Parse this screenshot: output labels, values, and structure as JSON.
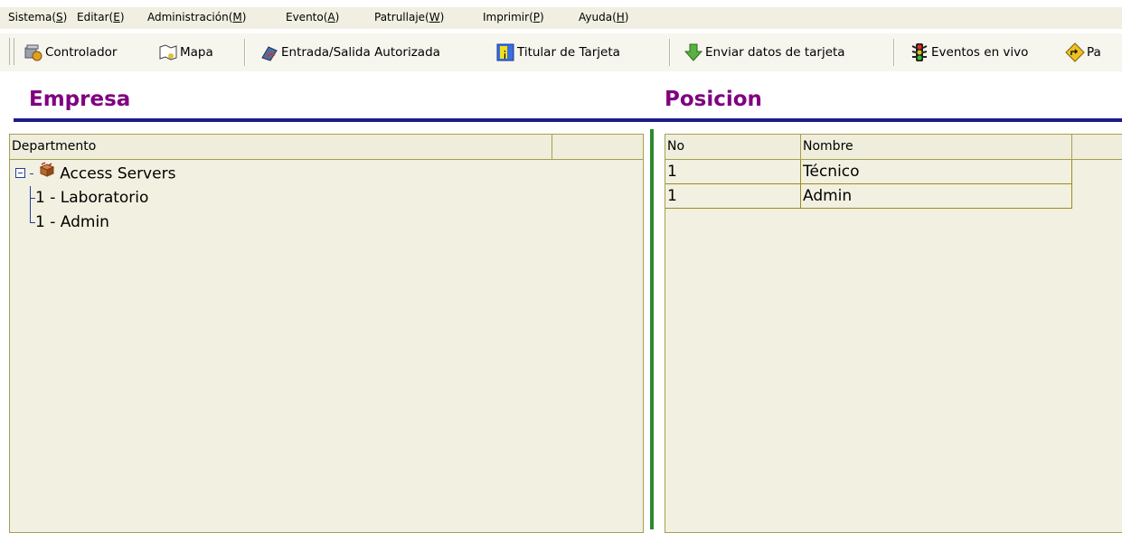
{
  "menu": [
    {
      "label": "Sistema(",
      "hot": "S",
      "end": ")"
    },
    {
      "label": "Editar(",
      "hot": "E",
      "end": ")"
    },
    {
      "label": "Administración(",
      "hot": "M",
      "end": ")"
    },
    {
      "label": "Evento(",
      "hot": "A",
      "end": ")"
    },
    {
      "label": "Patrullaje(",
      "hot": "W",
      "end": ")"
    },
    {
      "label": "Imprimir(",
      "hot": "P",
      "end": ")"
    },
    {
      "label": "Ayuda(",
      "hot": "H",
      "end": ")"
    }
  ],
  "toolbar": {
    "controlador": "Controlador",
    "mapa": "Mapa",
    "entrada_salida": "Entrada/Salida Autorizada",
    "titular": "Titular de Tarjeta",
    "enviar": "Enviar datos de tarjeta",
    "eventos": "Eventos en vivo",
    "partial": "Pa"
  },
  "left": {
    "title": "Empresa",
    "column": "Departmento",
    "tree": {
      "root": "Access Servers",
      "children": [
        "1 - Laboratorio",
        "1 - Admin"
      ]
    }
  },
  "right": {
    "title": "Posicion",
    "columns": [
      "No",
      "Nombre"
    ],
    "rows": [
      {
        "no": "1",
        "nombre": "Técnico"
      },
      {
        "no": "1",
        "nombre": "Admin"
      }
    ]
  },
  "colors": {
    "title": "#800080",
    "rule": "#1c1c8c",
    "splitter": "#2d8a2d",
    "panel_bg": "#f2f0e0"
  }
}
